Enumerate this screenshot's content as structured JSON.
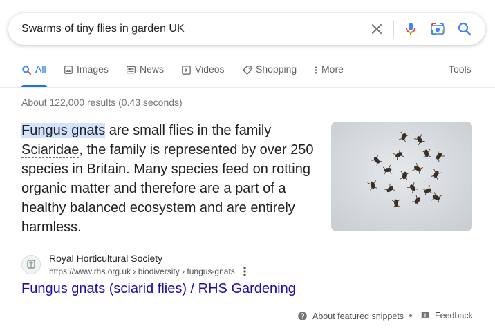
{
  "search": {
    "query": "Swarms of tiny flies in garden UK",
    "icons": [
      "clear-icon",
      "microphone-icon",
      "camera-lens-icon",
      "search-icon"
    ]
  },
  "tabs": [
    {
      "label": "All",
      "icon": "search-icon",
      "active": true
    },
    {
      "label": "Images",
      "icon": "image-icon"
    },
    {
      "label": "News",
      "icon": "news-icon"
    },
    {
      "label": "Videos",
      "icon": "play-icon"
    },
    {
      "label": "Shopping",
      "icon": "tag-icon"
    },
    {
      "label": "More",
      "icon": "kebab-icon"
    }
  ],
  "tools_label": "Tools",
  "result_stats": "About 122,000 results (0.43 seconds)",
  "featured_snippet": {
    "highlight": "Fungus gnats",
    "text_part1": " are small flies in the family ",
    "term": "Sciaridae",
    "text_part2": ", the family is represented by over 250 species in Britain. Many species feed on rotting organic matter and therefore are a part of a healthy balanced ecosystem and are entirely harmless.",
    "image_icon": "fungus-gnats-image"
  },
  "source": {
    "site_name": "Royal Horticultural Society",
    "url": "https://www.rhs.org.uk › biodiversity › fungus-gnats"
  },
  "result_title": "Fungus gnats (sciarid flies) / RHS Gardening",
  "footer": {
    "about": "About featured snippets",
    "feedback": "Feedback"
  },
  "colors": {
    "accent": "#1a73e8",
    "link": "#1a0dab",
    "highlight": "#d3e3fd",
    "text": "#202124",
    "muted": "#70757a"
  }
}
